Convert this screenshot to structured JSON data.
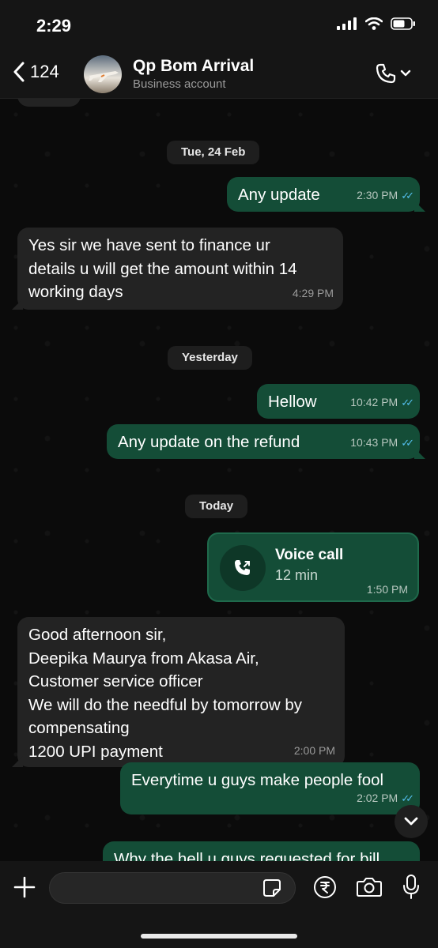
{
  "status": {
    "time": "2:29"
  },
  "header": {
    "back_count": "124",
    "contact_name": "Qp Bom Arrival",
    "subtitle": "Business account"
  },
  "dates": {
    "first": "Tue, 24 Feb",
    "second": "Yesterday",
    "third": "Today"
  },
  "messages": [
    {
      "dir": "out",
      "text": "Any update",
      "time": "2:30 PM",
      "ticks": "✓✓"
    },
    {
      "dir": "in",
      "lines": [
        "Yes sir we have sent to finance ur",
        "details u will get the amount within 14",
        "working days"
      ],
      "time": "4:29 PM"
    },
    {
      "dir": "out",
      "text": "Hellow",
      "time": "10:42 PM",
      "ticks": "✓✓"
    },
    {
      "dir": "out",
      "text": "Any update on the refund",
      "time": "10:43 PM",
      "ticks": "✓✓"
    },
    {
      "dir": "in",
      "lines": [
        "Good afternoon sir,",
        "Deepika Maurya from Akasa Air,",
        "Customer service officer",
        "We will do the needful by tomorrow by",
        "compensating",
        "1200 UPI payment"
      ],
      "time": "2:00 PM"
    },
    {
      "dir": "out",
      "text": "Everytime u guys make people fool",
      "time": "2:02 PM",
      "ticks": "✓✓"
    },
    {
      "dir": "out",
      "text": "Why the hell u guys requested for bill"
    }
  ],
  "voice_call": {
    "title": "Voice call",
    "duration": "12 min",
    "time": "1:50 PM"
  },
  "colors": {
    "outgoing": "#144d37",
    "incoming": "#232323",
    "read_ticks": "#53bdeb"
  },
  "icons": [
    "back-chevron-icon",
    "phone-icon",
    "chevron-down-icon",
    "plus-icon",
    "sticker-icon",
    "rupee-icon",
    "camera-icon",
    "mic-icon",
    "outgoing-call-icon"
  ]
}
